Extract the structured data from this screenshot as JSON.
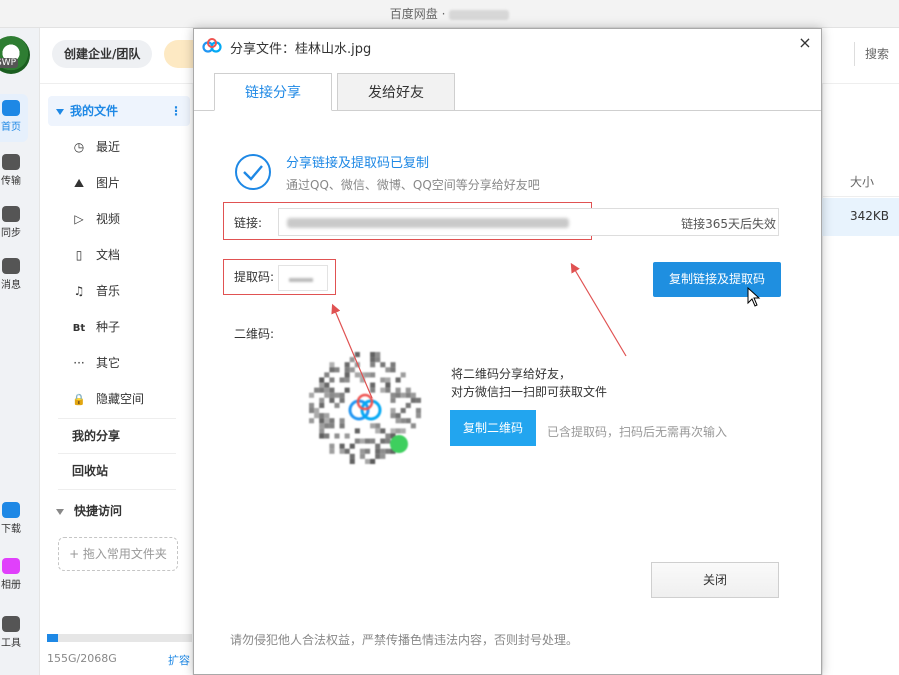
{
  "window": {
    "title": "百度网盘 ·"
  },
  "topbar": {
    "enterprise": "创建企业/团队",
    "search": "搜索"
  },
  "rail": {
    "avatar_tag": "SWP",
    "items": [
      "首页",
      "传输",
      "同步",
      "消息",
      "下载",
      "相册",
      "工具"
    ]
  },
  "sidebar": {
    "my_files": "我的文件",
    "more": "⋮",
    "items": [
      {
        "label": "最近",
        "icon": "clock-icon",
        "glyph": "◷"
      },
      {
        "label": "图片",
        "icon": "image-icon",
        "glyph": "⛰"
      },
      {
        "label": "视频",
        "icon": "play-icon",
        "glyph": "▷"
      },
      {
        "label": "文档",
        "icon": "document-icon",
        "glyph": "▯"
      },
      {
        "label": "音乐",
        "icon": "headphones-icon",
        "glyph": "♫"
      },
      {
        "label": "种子",
        "icon": "bt-icon",
        "glyph": "Bt"
      },
      {
        "label": "其它",
        "icon": "more-icon",
        "glyph": "···"
      },
      {
        "label": "隐藏空间",
        "icon": "lock-icon",
        "glyph": "🔒"
      }
    ],
    "my_share": "我的分享",
    "recycle": "回收站",
    "quick_access": "快捷访问",
    "drop_fav": "+ 拖入常用文件夹",
    "storage": "155G/2068G",
    "expand": "扩容",
    "storage_used_fraction": 0.075
  },
  "table": {
    "col_size": "大小",
    "row_size": "342KB"
  },
  "dialog": {
    "title": "分享文件：桂林山水.jpg",
    "close": "×",
    "tabs": [
      "链接分享",
      "发给好友"
    ],
    "success_title": "分享链接及提取码已复制",
    "success_sub": "通过QQ、微信、微博、QQ空间等分享给好友吧",
    "link_label": "链接:",
    "link_expire": "链接365天后失效",
    "code_label": "提取码:",
    "copy_link_btn": "复制链接及提取码",
    "qr_label": "二维码:",
    "qr_tip1": "将二维码分享给好友，",
    "qr_tip2": "对方微信扫一扫即可获取文件",
    "copy_qr_btn": "复制二维码",
    "qr_note": "已含提取码，扫码后无需再次输入",
    "close_btn": "关闭",
    "footer": "请勿侵犯他人合法权益，严禁传播色情违法内容，否则封号处理。"
  },
  "colors": {
    "accent": "#1e88e5",
    "annotation": "#e05252"
  }
}
